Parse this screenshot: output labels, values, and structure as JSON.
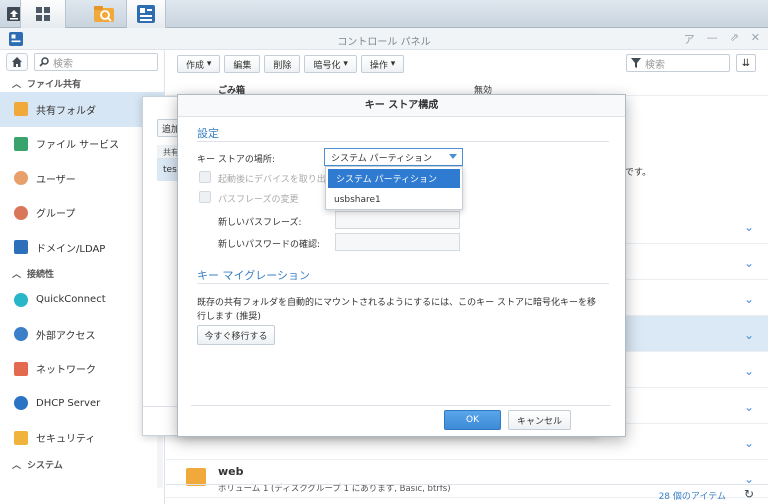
{
  "window": {
    "title": "コントロール パネル"
  },
  "sidebar": {
    "search_placeholder": "検索",
    "sections": [
      {
        "label": "ファイル共有"
      },
      {
        "label": "接続性"
      },
      {
        "label": "システム"
      }
    ],
    "items": [
      {
        "label": "共有フォルダ",
        "icon": "shared-folder-icon",
        "color": "#f2a93b"
      },
      {
        "label": "ファイル サービス",
        "icon": "file-services-icon",
        "color": "#3aa36b"
      },
      {
        "label": "ユーザー",
        "icon": "user-icon",
        "color": "#e8a06a"
      },
      {
        "label": "グループ",
        "icon": "group-icon",
        "color": "#d9775a"
      },
      {
        "label": "ドメイン/LDAP",
        "icon": "domain-icon",
        "color": "#2d6fb8"
      },
      {
        "label": "QuickConnect",
        "icon": "quickconnect-icon",
        "color": "#29b6c8"
      },
      {
        "label": "外部アクセス",
        "icon": "globe-icon",
        "color": "#3b7fc9"
      },
      {
        "label": "ネットワーク",
        "icon": "network-home-icon",
        "color": "#e46a4f"
      },
      {
        "label": "DHCP Server",
        "icon": "dhcp-icon",
        "color": "#2b74c4"
      },
      {
        "label": "セキュリティ",
        "icon": "shield-icon",
        "color": "#f0b43c"
      }
    ]
  },
  "toolbar": {
    "create_label": "作成",
    "edit_label": "編集",
    "delete_label": "削除",
    "encrypt_label": "暗号化",
    "action_label": "操作",
    "filter_placeholder": "検索"
  },
  "list": {
    "top_row_label": "ごみ箱",
    "top_row_value": "無効",
    "add_label": "追加",
    "share_col": "共有",
    "test_cell": "test",
    "partial_text": "動先です。",
    "web_name": "web",
    "web_desc": "ボリューム 1 (ディスクグループ 1 にあります, Basic, btrfs)",
    "item_count": "28 個のアイテム"
  },
  "dialog": {
    "title": "キー ストア構成",
    "settings_title": "設定",
    "key_store_label": "キー ストアの場所:",
    "key_store_value": "システム パーティション",
    "options": [
      "システム パーティション",
      "usbshare1"
    ],
    "automount_label": "起動後にデバイスを取り出す",
    "change_passphrase_label": "パスフレーズの変更",
    "new_passphrase_label": "新しいパスフレーズ:",
    "confirm_password_label": "新しいパスワードの確認:",
    "migration_title": "キー マイグレーション",
    "migration_text_1": "既存の共有フォルダを自動的にマウントされるようにするには、このキー ストアに暗号化キーを移",
    "migration_text_2": "行します (推奨)",
    "migrate_button": "今すぐ移行する",
    "ok_label": "OK",
    "cancel_label": "キャンセル"
  },
  "colors": {
    "accent": "#3a7fc4",
    "primary_button": "#3d8ad8",
    "selection": "#2e7bd1"
  }
}
